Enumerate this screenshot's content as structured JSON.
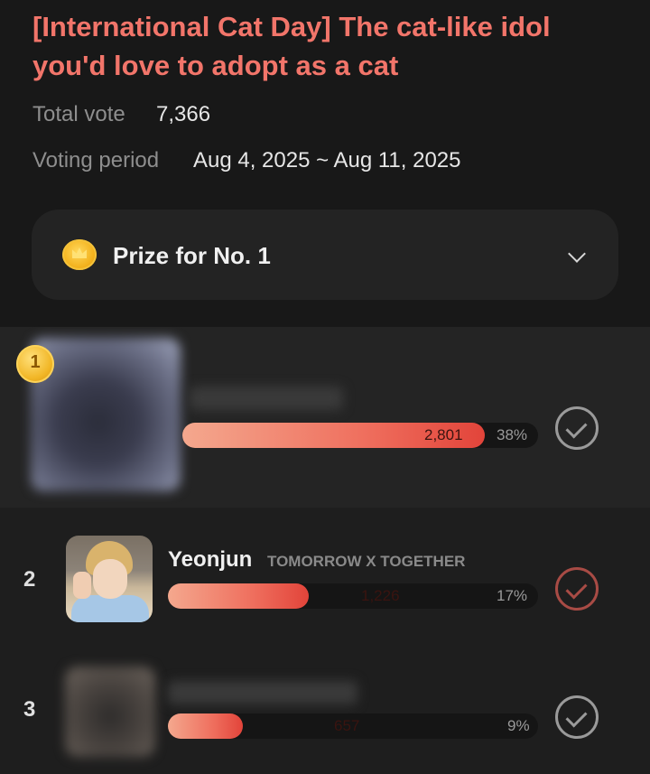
{
  "poll": {
    "title": "[International Cat Day] The cat-like idol\nyou'd love to adopt  as a cat",
    "total_label": "Total vote",
    "total_value": "7,366",
    "period_label": "Voting period",
    "period_value": "Aug 4, 2025 ~ Aug 11, 2025"
  },
  "prize": {
    "label": "Prize for No. 1",
    "icon": "coin-crown-icon"
  },
  "colors": {
    "accent": "#f2756a",
    "bar_start": "#f4a88e",
    "bar_end": "#e2443a",
    "background": "#181818"
  },
  "entries": [
    {
      "rank": "1",
      "badge": "1",
      "name": "",
      "group": "",
      "votes": "2,801",
      "percent": "38%",
      "fraction": 0.38
    },
    {
      "rank": "2",
      "name": "Yeonjun",
      "group": "TOMORROW X TOGETHER",
      "votes": "1,226",
      "percent": "17%",
      "fraction": 0.17
    },
    {
      "rank": "3",
      "name": "",
      "group": "",
      "votes": "657",
      "percent": "9%",
      "fraction": 0.09
    }
  ]
}
